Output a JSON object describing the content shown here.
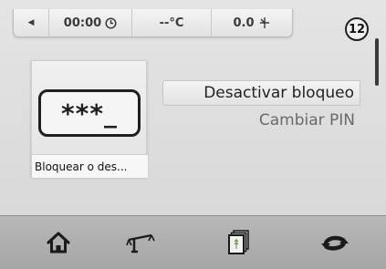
{
  "status_bar": {
    "back_icon": "left-arrow-icon",
    "time": "00:00",
    "time_icon": "clock-icon",
    "temperature": "--°C",
    "wind_speed": "0.0",
    "wind_icon": "wind-turbine-icon"
  },
  "badge": "12",
  "lock_tile": {
    "pin_display": "***_",
    "label": "Bloquear o des..."
  },
  "menu": {
    "items": [
      {
        "label": "Desactivar bloqueo",
        "selected": true
      },
      {
        "label": "Cambiar PIN",
        "selected": false
      }
    ]
  },
  "bottom_nav": {
    "items": [
      {
        "icon": "home-icon"
      },
      {
        "icon": "scale-icon"
      },
      {
        "icon": "document-stack-icon"
      },
      {
        "icon": "loop-arrows-icon"
      }
    ]
  },
  "colors": {
    "background": "#dcdcdc",
    "bottom_bar": "#b0b0b0",
    "icon": "#1a1a1a"
  }
}
